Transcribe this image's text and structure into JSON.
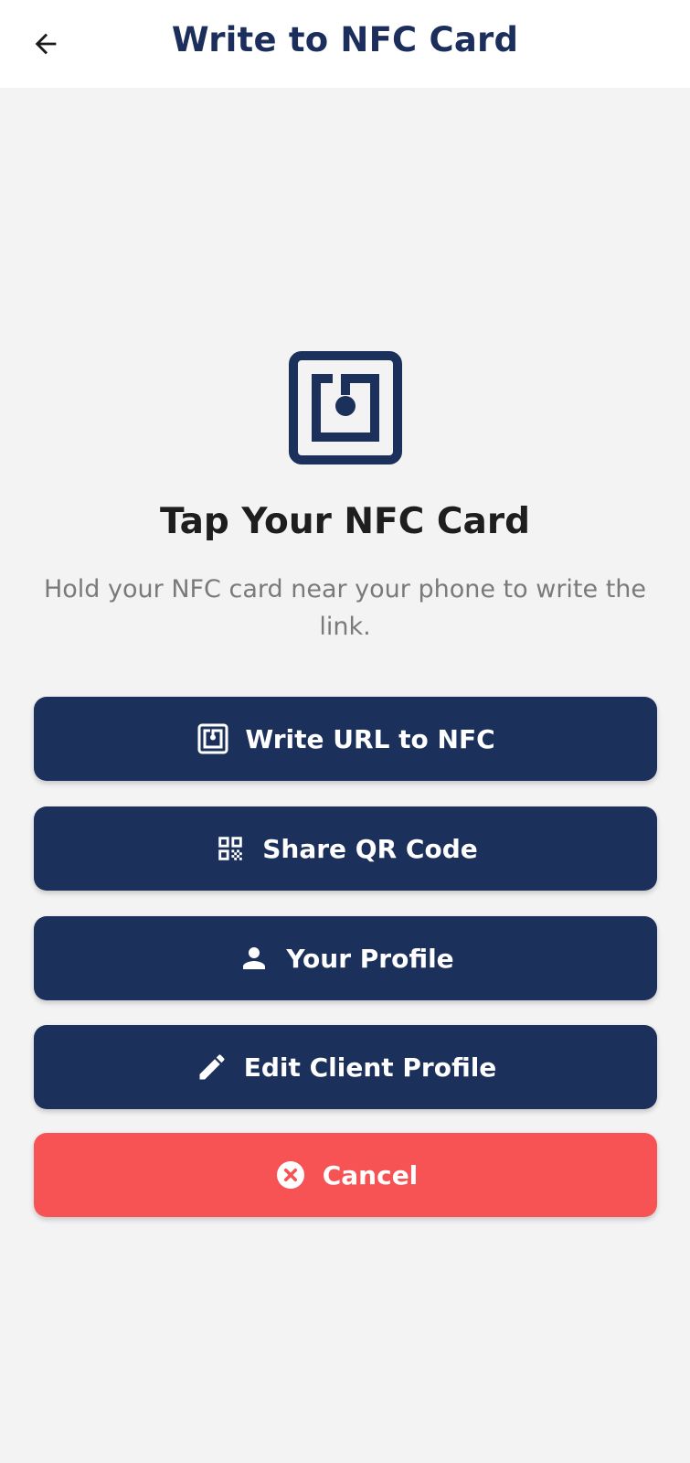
{
  "header": {
    "title": "Write to NFC Card",
    "back_icon": "arrow-left-icon"
  },
  "main": {
    "heading": "Tap Your NFC Card",
    "subtext": "Hold your NFC card near your phone to write the link.",
    "hero_icon": "nfc-icon"
  },
  "buttons": [
    {
      "label": "Write URL to NFC",
      "icon": "nfc-icon"
    },
    {
      "label": "Share QR Code",
      "icon": "qr-code-icon"
    },
    {
      "label": "Your Profile",
      "icon": "person-icon"
    },
    {
      "label": "Edit Client Profile",
      "icon": "pencil-icon"
    },
    {
      "label": "Cancel",
      "icon": "cancel-circle-icon"
    }
  ],
  "colors": {
    "primary": "#1c305c",
    "danger": "#f75354",
    "background": "#f3f3f4",
    "title": "#1c2f5c"
  }
}
